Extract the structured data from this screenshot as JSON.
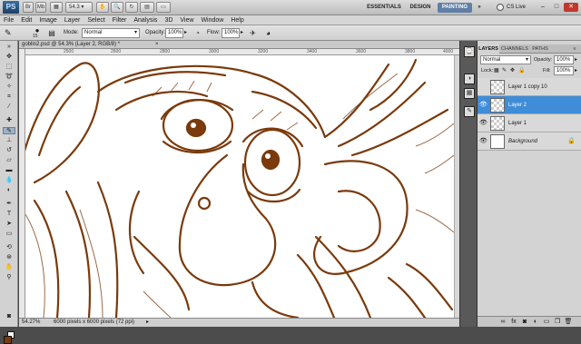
{
  "app": {
    "logo": "PS",
    "zoom_value": "54.3",
    "workspaces": [
      "ESSENTIALS",
      "DESIGN",
      "PAINTING"
    ],
    "active_workspace": "PAINTING",
    "cs_live": "CS Live",
    "window_buttons": [
      "–",
      "□",
      "✕"
    ]
  },
  "menu": [
    "File",
    "Edit",
    "Image",
    "Layer",
    "Select",
    "Filter",
    "Analysis",
    "3D",
    "View",
    "Window",
    "Help"
  ],
  "options": {
    "brush_size": "15",
    "mode_label": "Mode:",
    "mode_value": "Normal",
    "opacity_label": "Opacity:",
    "opacity_value": "100%",
    "flow_label": "Flow:",
    "flow_value": "100%"
  },
  "document": {
    "tab_title": "goblin2.psd @ 54.3% (Layer 2, RGB/8) *",
    "ruler_marks": [
      "2500",
      "2600",
      "2800",
      "3000",
      "3200",
      "3400",
      "3600",
      "3800",
      "4000"
    ],
    "zoom_status": "54.27%",
    "size_status": "6000 pixels x 6000 pixels (72 ppi)"
  },
  "panel": {
    "tabs": [
      "LAYERS",
      "CHANNELS",
      "PATHS"
    ],
    "blend_mode": "Normal",
    "opacity_label": "Opacity:",
    "opacity_value": "100%",
    "lock_label": "Lock:",
    "fill_label": "Fill:",
    "fill_value": "100%",
    "layers": [
      {
        "name": "Layer 1 copy 10",
        "selected": false
      },
      {
        "name": "Layer 2",
        "selected": true
      },
      {
        "name": "Layer 1",
        "selected": false
      },
      {
        "name": "Background",
        "selected": false
      }
    ],
    "bottom_icons": [
      "link",
      "fx",
      "mask",
      "adjust",
      "group",
      "new",
      "trash"
    ]
  },
  "colors": {
    "ink": "#7a3a0c",
    "foreground": "#7a3a0c",
    "background": "#ffffff",
    "selection": "#3f8cd8"
  }
}
